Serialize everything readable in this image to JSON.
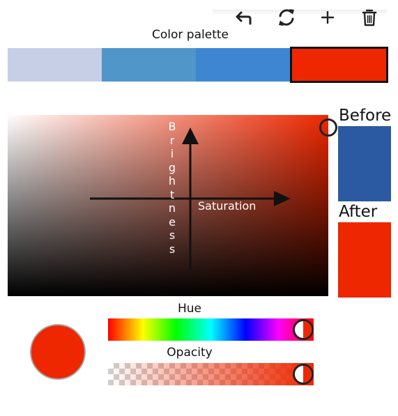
{
  "toolbar": {
    "undo_icon": "undo-icon",
    "refresh_icon": "refresh-icon",
    "add_icon": "plus-icon",
    "delete_icon": "trash-icon"
  },
  "palette": {
    "title": "Color palette",
    "swatches": [
      {
        "color": "#c6cfe6"
      },
      {
        "color": "#5196c8"
      },
      {
        "color": "#3f86d2"
      },
      {
        "color": "#ee2700",
        "selected": true
      }
    ]
  },
  "picker": {
    "hue_color": "#ee2700",
    "saturation_label": "Saturation",
    "brightness_label": "Brightness",
    "saturation": 1.0,
    "brightness": 0.93
  },
  "preview": {
    "before_label": "Before",
    "after_label": "After",
    "before_color": "#2c5aa2",
    "after_color": "#ee2700"
  },
  "current": {
    "color": "#ee2700"
  },
  "hue_slider": {
    "label": "Hue",
    "value": 0.95
  },
  "opacity_slider": {
    "label": "Opacity",
    "value": 0.95
  }
}
